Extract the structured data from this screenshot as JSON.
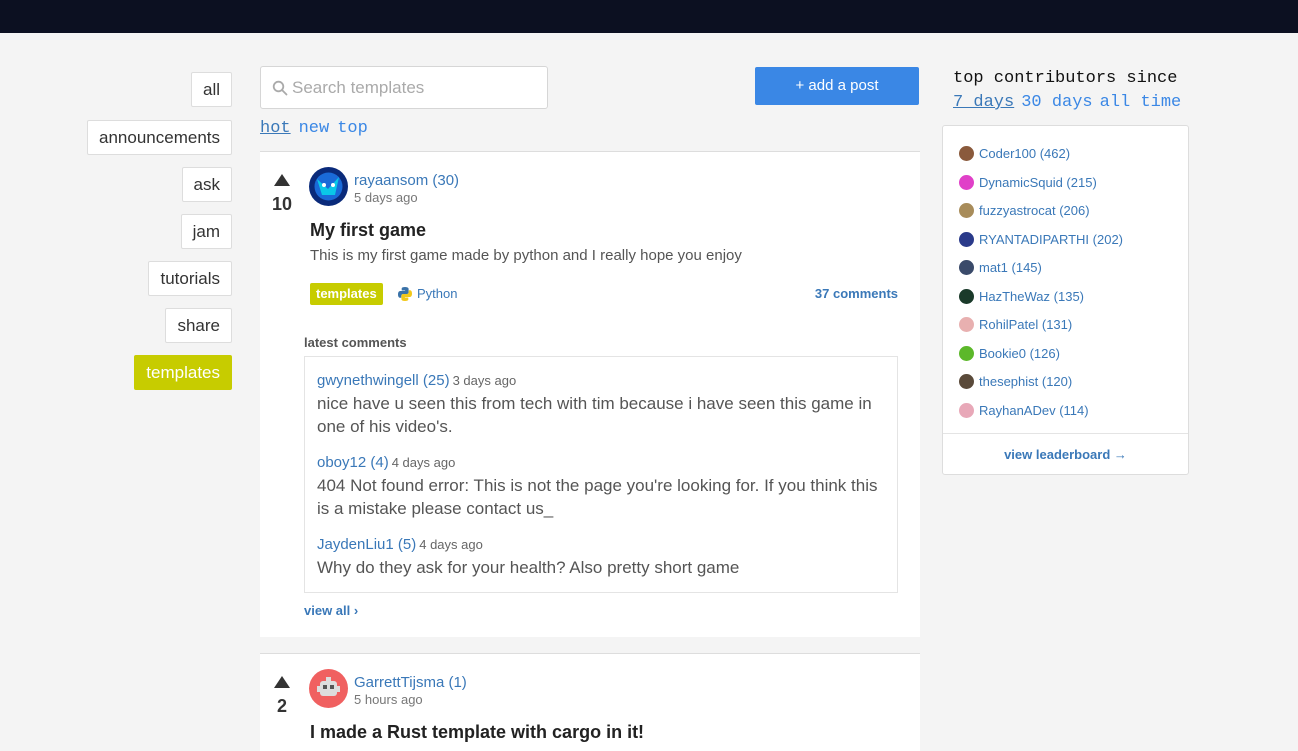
{
  "categories": [
    {
      "label": "all",
      "active": false
    },
    {
      "label": "announcements",
      "active": false
    },
    {
      "label": "ask",
      "active": false
    },
    {
      "label": "jam",
      "active": false
    },
    {
      "label": "tutorials",
      "active": false
    },
    {
      "label": "share",
      "active": false
    },
    {
      "label": "templates",
      "active": true
    }
  ],
  "search": {
    "placeholder": "Search templates",
    "value": ""
  },
  "add_post_label": "+ add a post",
  "sort": {
    "options": [
      "hot",
      "new",
      "top"
    ],
    "selected": "hot"
  },
  "posts": [
    {
      "votes": "10",
      "author": "rayaansom (30)",
      "time": "5 days ago",
      "title": "My first game",
      "description": "This is my first game made by python and I really hope you enjoy",
      "tag": "templates",
      "language": "Python",
      "comments_count": "37 comments",
      "latest_comments_label": "latest comments",
      "latest_comments": [
        {
          "author": "gwynethwingell (25)",
          "time": "3 days ago",
          "body": "nice have u seen this from tech with tim because i have seen this game in one of his video's."
        },
        {
          "author": "oboy12 (4)",
          "time": "4 days ago",
          "body": "404 Not found error: This is not the page you're looking for. If you think this is a mistake please contact us_"
        },
        {
          "author": "JaydenLiu1 (5)",
          "time": "4 days ago",
          "body": "Why do they ask for your health? Also pretty short game"
        }
      ],
      "view_all_label": "view all ›"
    },
    {
      "votes": "2",
      "author": "GarrettTijsma (1)",
      "time": "5 hours ago",
      "title": "I made a Rust template with cargo in it!"
    }
  ],
  "contributors": {
    "heading": "top contributors since",
    "periods": [
      "7 days",
      "30 days",
      "all time"
    ],
    "selected_period": "7 days",
    "list": [
      {
        "label": "Coder100 (462)",
        "color": "#8a5a3c"
      },
      {
        "label": "DynamicSquid (215)",
        "color": "#e040c8"
      },
      {
        "label": "fuzzyastrocat (206)",
        "color": "#a88c5a"
      },
      {
        "label": "RYANTADIPARTHI (202)",
        "color": "#2a3a8a"
      },
      {
        "label": "mat1 (145)",
        "color": "#3a4a6a"
      },
      {
        "label": "HazTheWaz (135)",
        "color": "#1a3a2a"
      },
      {
        "label": "RohilPatel (131)",
        "color": "#e8b0b0"
      },
      {
        "label": "Bookie0 (126)",
        "color": "#5cb82a"
      },
      {
        "label": "thesephist (120)",
        "color": "#5a4a3a"
      },
      {
        "label": "RayhanADev (114)",
        "color": "#e8a8b8"
      }
    ],
    "view_leaderboard_label": "view leaderboard →"
  }
}
